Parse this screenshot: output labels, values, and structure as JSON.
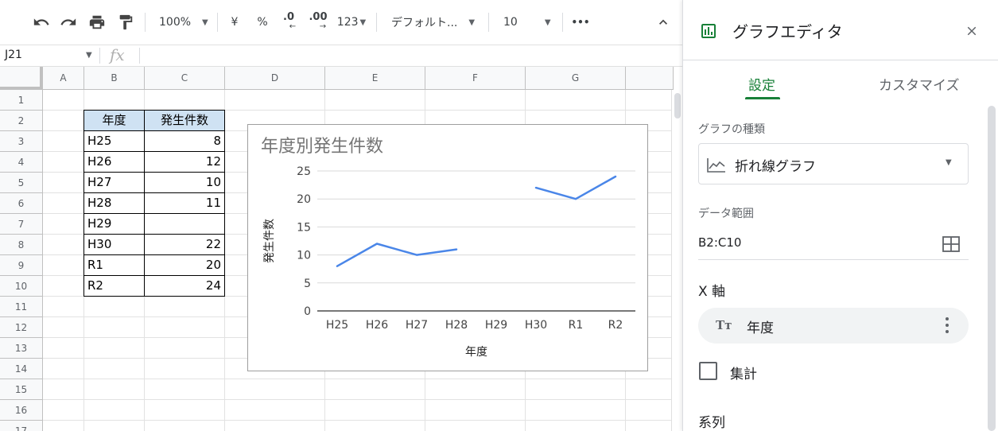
{
  "toolbar": {
    "zoom": "100%",
    "currency": "¥",
    "percent": "%",
    "decrease_decimal": ".0",
    "increase_decimal": ".00",
    "number_format": "123",
    "font": "デフォルト...",
    "font_size": "10",
    "more": "•••"
  },
  "formula_bar": {
    "name_box": "J21",
    "fx": "fx"
  },
  "sheet": {
    "columns": [
      "A",
      "B",
      "C",
      "D",
      "E",
      "F",
      "G"
    ],
    "rows": [
      "1",
      "2",
      "3",
      "4",
      "5",
      "6",
      "7",
      "8",
      "9",
      "10",
      "11",
      "12",
      "13",
      "14",
      "15",
      "16",
      "17"
    ],
    "table": {
      "headers": [
        "年度",
        "発生件数"
      ],
      "rows": [
        [
          "H25",
          "8"
        ],
        [
          "H26",
          "12"
        ],
        [
          "H27",
          "10"
        ],
        [
          "H28",
          "11"
        ],
        [
          "H29",
          ""
        ],
        [
          "H30",
          "22"
        ],
        [
          "R1",
          "20"
        ],
        [
          "R2",
          "24"
        ]
      ]
    }
  },
  "chart_data": {
    "type": "line",
    "title": "年度別発生件数",
    "xlabel": "年度",
    "ylabel": "発生件数",
    "categories": [
      "H25",
      "H26",
      "H27",
      "H28",
      "H29",
      "H30",
      "R1",
      "R2"
    ],
    "values": [
      8,
      12,
      10,
      11,
      null,
      22,
      20,
      24
    ],
    "ylim": [
      0,
      25
    ],
    "yticks": [
      0,
      5,
      10,
      15,
      20,
      25
    ],
    "grid": true,
    "line_color": "#4a86e8"
  },
  "editor": {
    "title": "グラフエディタ",
    "tabs": [
      "設定",
      "カスタマイズ"
    ],
    "chart_type_label": "グラフの種類",
    "chart_type_value": "折れ線グラフ",
    "data_range_label": "データ範囲",
    "data_range_value": "B2:C10",
    "x_axis_label": "X 軸",
    "x_axis_chip_icon": "Tт",
    "x_axis_value": "年度",
    "aggregate_label": "集計",
    "series_label": "系列",
    "accent_color": "#188038"
  }
}
